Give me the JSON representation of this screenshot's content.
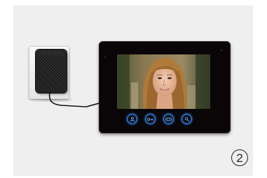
{
  "scene": {
    "step_number": "2",
    "colors": {
      "background": "#efefef",
      "monitor_body": "#0a0607",
      "button_glow": "#2e8bff"
    }
  },
  "monitor": {
    "buttons": [
      {
        "name": "unlock-button",
        "icon": "person-icon"
      },
      {
        "name": "key-button",
        "icon": "key-icon"
      },
      {
        "name": "talk-button",
        "icon": "intercom-icon"
      },
      {
        "name": "menu-button",
        "icon": "settings-icon"
      }
    ]
  }
}
